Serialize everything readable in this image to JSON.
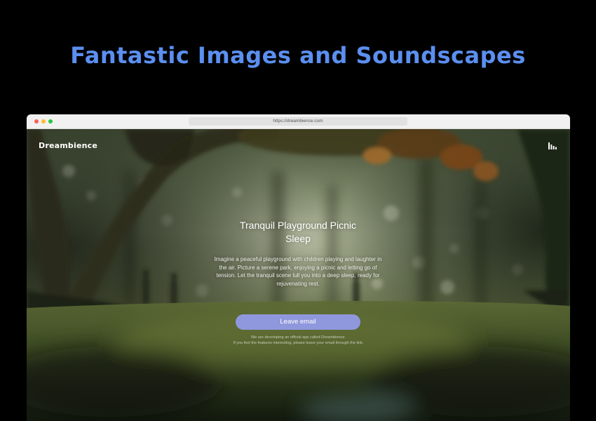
{
  "headline": "Fantastic Images and Soundscapes",
  "browser": {
    "url": "https://dreambience.com"
  },
  "site": {
    "logo": "Dreambience",
    "menu_icon": "bars-icon",
    "title": "Tranquil Playground Picnic Sleep",
    "description": "Imagine a peaceful playground with children playing and laughter in the air. Picture a serene park, enjoying a picnic and letting go of tension. Let the tranquil scene lull you into a deep sleep, ready for rejuvenating rest.",
    "cta_label": "Leave email",
    "note_line1": "We are developing an official app called Dreambience.",
    "note_line2": "If you feel the features interesting, please leave your email through the link."
  },
  "colors": {
    "headline": "#5b8ff0",
    "cta": "#8f98dc",
    "page_bg": "#000000"
  }
}
